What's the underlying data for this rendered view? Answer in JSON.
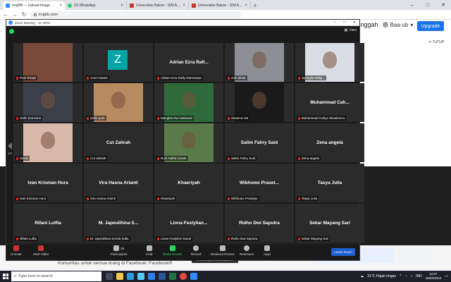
{
  "browser": {
    "tabs": [
      {
        "title": "ImgBB — Upload Image — Free Image Hosting",
        "color": "#2d8cff",
        "active": true
      },
      {
        "title": "(3) WhatsApp",
        "color": "#25d366",
        "active": false
      },
      {
        "title": "Universitas Bakrie - SIM Akademik",
        "color": "#c0392b",
        "active": false
      },
      {
        "title": "Universitas Bakrie - SIM Akademik",
        "color": "#c0392b",
        "active": false
      }
    ],
    "new_tab": "+",
    "url": "imgbb.com"
  },
  "page": {
    "unggah": "Unggah",
    "user": "Baa-ub",
    "upgrade": "Upgrade",
    "tutup": "✕ TUTUP",
    "facebook_text": "Komunitas untuk semua orang di Facebook: Facebook®"
  },
  "zoom": {
    "title": "Zoom Meeting - 44 VR01",
    "view": "View",
    "page_left": "1/3",
    "page_right": "1/3",
    "unassigned": "2 unassigned participants",
    "tiles": [
      {
        "label": "Putri Rizqia",
        "big": "",
        "video": true,
        "vcolor": "#7a4a3a"
      },
      {
        "label": "zoom baa04",
        "big": "",
        "video": false,
        "zicon": "Z"
      },
      {
        "label": "Adrian Ezra Rafly Darmawan",
        "big": "Adrian Ezra Rafl...",
        "video": false
      },
      {
        "label": "sufri albab",
        "big": "",
        "video": true,
        "vcolor": "#8c8f96"
      },
      {
        "label": "Syangita Rafgi...",
        "big": "",
        "video": true,
        "vcolor": "#d9dde3"
      },
      {
        "label": "Hafiz Zamzami",
        "big": "",
        "video": true,
        "vcolor": "#3a3f4a"
      },
      {
        "label": "saiful patri",
        "big": "",
        "video": true,
        "vcolor": "#b88a60"
      },
      {
        "label": "Mangkla Dwi Saharani",
        "big": "",
        "video": true,
        "vcolor": "#2f6b3a"
      },
      {
        "label": "Sisaena Hia",
        "big": "",
        "video": true,
        "vcolor": "#1a1a1a"
      },
      {
        "label": "Muhammad Cahyo Wicaksono",
        "big": "Muhammad Cah...",
        "video": false
      },
      {
        "label": "Selvin",
        "big": "",
        "video": true,
        "vcolor": "#d8b8a8"
      },
      {
        "label": "Cut Zahrah",
        "big": "Cut Zahrah",
        "video": false
      },
      {
        "label": "Nurli Naflul Umam",
        "big": "",
        "video": true,
        "vcolor": "#5a7a4a"
      },
      {
        "label": "Salim Fahry Said",
        "big": "Salim Fahry Said",
        "video": false
      },
      {
        "label": "Zena angela",
        "big": "Zena angela",
        "video": false
      },
      {
        "label": "Ivan Krisman Hura",
        "big": "Ivan Krisman Hura",
        "video": false
      },
      {
        "label": "Vira Hasna Arianti",
        "big": "Vira Hasna Arianti",
        "video": false
      },
      {
        "label": "Khaeriyah",
        "big": "Khaeriyah",
        "video": false
      },
      {
        "label": "Wibhowo Prasetyo",
        "big": "Wibhowo Praset...",
        "video": false
      },
      {
        "label": "Tasya Julia",
        "big": "Tasya Julia",
        "video": false
      },
      {
        "label": "Rifani Lutfia",
        "big": "Rifani Lutfia",
        "video": false
      },
      {
        "label": "M. Japeulihina Senda Solla",
        "big": "M. Japeulihina S...",
        "video": false
      },
      {
        "label": "Liona Festylian Daval",
        "big": "Liona Festylian...",
        "video": false
      },
      {
        "label": "Ridho Dwi Saputra",
        "big": "Ridho Dwi Saputra",
        "video": false
      },
      {
        "label": "Sekar Mayang Sari",
        "big": "Sekar Mayang Sari",
        "video": false
      }
    ],
    "controls": {
      "unmute": "Unmute",
      "start_video": "Start Video",
      "participants": "Participants",
      "participants_count": "56",
      "chat": "Chat",
      "share": "Share Screen",
      "record": "Record",
      "breakout": "Breakout Rooms",
      "reactions": "Reactions",
      "apps": "Apps",
      "leave": "Leave Room"
    }
  },
  "taskbar": {
    "search_placeholder": "Type here to search",
    "weather": "31°C  Hujan ringan",
    "lang": "IND",
    "time": "11:07",
    "date": "16/03/2022"
  }
}
